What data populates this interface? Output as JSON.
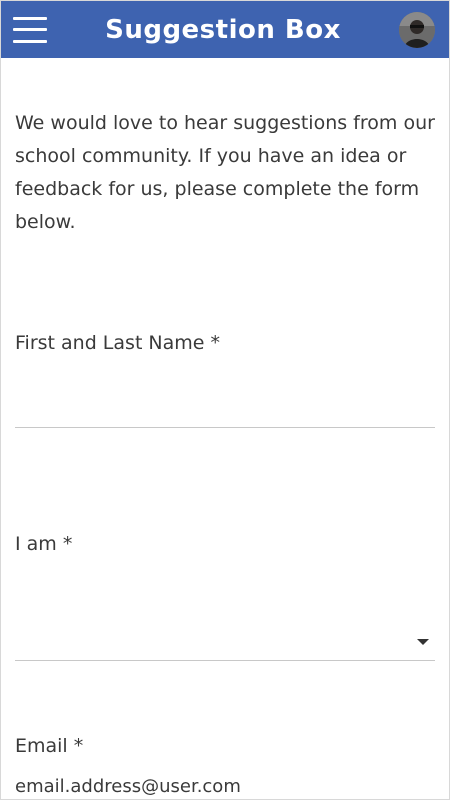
{
  "header": {
    "title": "Suggestion Box",
    "menu_icon": "hamburger-menu-icon",
    "avatar_icon": "user-avatar",
    "background_color": "#3e63b0"
  },
  "intro": {
    "text": "We would love to hear suggestions from our school community. If you have an idea or feedback for us, please complete the form below."
  },
  "form": {
    "name_field": {
      "label": "First and Last Name *",
      "value": ""
    },
    "role_field": {
      "label": "I am *",
      "selected_value": "",
      "icon": "dropdown-arrow-icon"
    },
    "email_field": {
      "label": "Email *",
      "value": "email.address@user.com"
    }
  }
}
